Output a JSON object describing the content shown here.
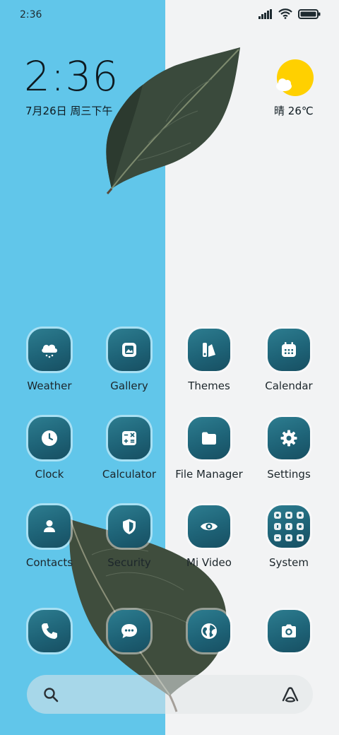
{
  "status_bar": {
    "time": "2:36",
    "icons": [
      "signal-icon",
      "wifi-icon",
      "battery-icon"
    ]
  },
  "clock_widget": {
    "time": "2:36",
    "date": "7月26日 周三下午"
  },
  "weather_widget": {
    "condition": "晴",
    "temperature": "26℃",
    "icon": "sun-cloud-icon"
  },
  "apps": [
    {
      "label": "Weather",
      "icon": "cloud-snow-icon"
    },
    {
      "label": "Gallery",
      "icon": "image-icon"
    },
    {
      "label": "Themes",
      "icon": "themes-icon"
    },
    {
      "label": "Calendar",
      "icon": "calendar-icon"
    },
    {
      "label": "Clock",
      "icon": "clock-icon"
    },
    {
      "label": "Calculator",
      "icon": "calculator-icon"
    },
    {
      "label": "File Manager",
      "icon": "folder-icon"
    },
    {
      "label": "Settings",
      "icon": "gear-icon"
    },
    {
      "label": "Contacts",
      "icon": "person-icon"
    },
    {
      "label": "Security",
      "icon": "shield-icon"
    },
    {
      "label": "Mi Video",
      "icon": "eye-icon"
    },
    {
      "label": "System",
      "icon": "folder-grid-icon"
    }
  ],
  "dock": [
    {
      "icon": "phone-icon"
    },
    {
      "icon": "message-icon"
    },
    {
      "icon": "globe-icon"
    },
    {
      "icon": "camera-icon"
    }
  ],
  "search_bar": {
    "left_icon": "search-icon",
    "right_icon": "assistant-icon"
  },
  "colors": {
    "wallpaper_left": "#61c6ea",
    "wallpaper_right": "#f2f3f4",
    "icon_bg": "#1e6377",
    "sun": "#ffd000"
  }
}
